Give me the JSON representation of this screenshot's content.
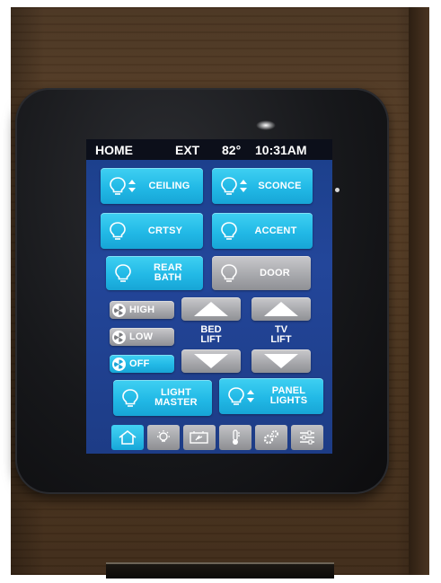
{
  "status_bar": {
    "screen_title": "HOME",
    "ext_label": "EXT",
    "temperature": "82°",
    "time": "10:31AM"
  },
  "lights": {
    "ceiling": {
      "label": "CEILING",
      "icon": "bulb-dimmable-icon"
    },
    "sconce": {
      "label": "SCONCE",
      "icon": "bulb-dimmable-icon"
    },
    "crtsy": {
      "label": "CRTSY",
      "icon": "bulb-icon"
    },
    "accent": {
      "label": "ACCENT",
      "icon": "bulb-icon"
    },
    "rear_bath": {
      "line1": "REAR",
      "line2": "BATH",
      "icon": "bulb-icon"
    },
    "door": {
      "label": "DOOR",
      "icon": "bulb-icon"
    },
    "light_master": {
      "line1": "LIGHT",
      "line2": "MASTER",
      "icon": "bulb-icon"
    },
    "panel_lights": {
      "line1": "PANEL",
      "line2": "LIGHTS",
      "icon": "bulb-dimmable-icon"
    }
  },
  "fan": {
    "high": "HIGH",
    "low": "LOW",
    "off": "OFF",
    "active_setting": "OFF"
  },
  "bed_lift": {
    "line1": "BED",
    "line2": "LIFT"
  },
  "tv_lift": {
    "line1": "TV",
    "line2": "LIFT"
  },
  "tabs": [
    {
      "icon": "home-icon",
      "active": true
    },
    {
      "icon": "light-bulb-icon",
      "active": false
    },
    {
      "icon": "battery-icon",
      "active": false
    },
    {
      "icon": "thermometer-icon",
      "active": false
    },
    {
      "icon": "gears-icon",
      "active": false
    },
    {
      "icon": "settings-sliders-icon",
      "active": false
    }
  ],
  "colors": {
    "button_on": "#22b9e6",
    "button_off": "#a8a9ad",
    "screen_bg": "#23469a",
    "status_bar_bg": "#0c0f1a"
  }
}
